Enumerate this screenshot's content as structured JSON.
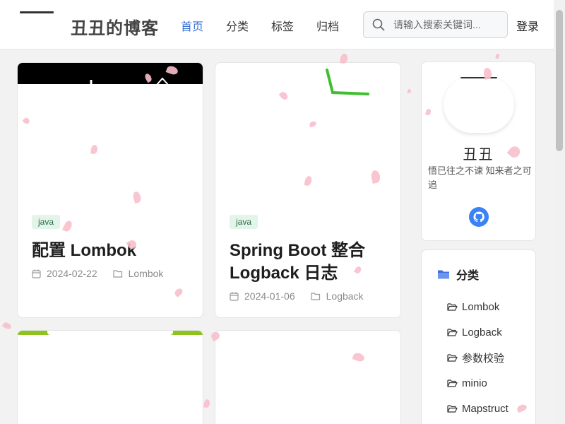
{
  "header": {
    "brand": "丑丑的博客",
    "nav": [
      "首页",
      "分类",
      "标签",
      "归档"
    ],
    "active_nav": "首页",
    "search_placeholder": "请输入搜索关键词...",
    "search_value": "",
    "login": "登录"
  },
  "posts": [
    {
      "tag": "java",
      "title": "配置 Lombok",
      "date": "2024-02-22",
      "category": "Lombok"
    },
    {
      "tag": "java",
      "title": "Spring Boot 整合 Logback 日志",
      "date": "2024-01-06",
      "category": "Logback"
    }
  ],
  "profile": {
    "name": "丑丑",
    "motto": "悟已往之不谏 知来者之可追",
    "social_icon": "github-icon"
  },
  "categories": {
    "heading": "分类",
    "items": [
      "Lombok",
      "Logback",
      "参数校验",
      "minio",
      "Mapstruct"
    ]
  },
  "colors": {
    "accent": "#3a6fd8",
    "tag_bg": "#e3f5ea",
    "tag_text": "#2d6a45",
    "petal": "#f7bfcb",
    "github_bg": "#3b82f6"
  }
}
